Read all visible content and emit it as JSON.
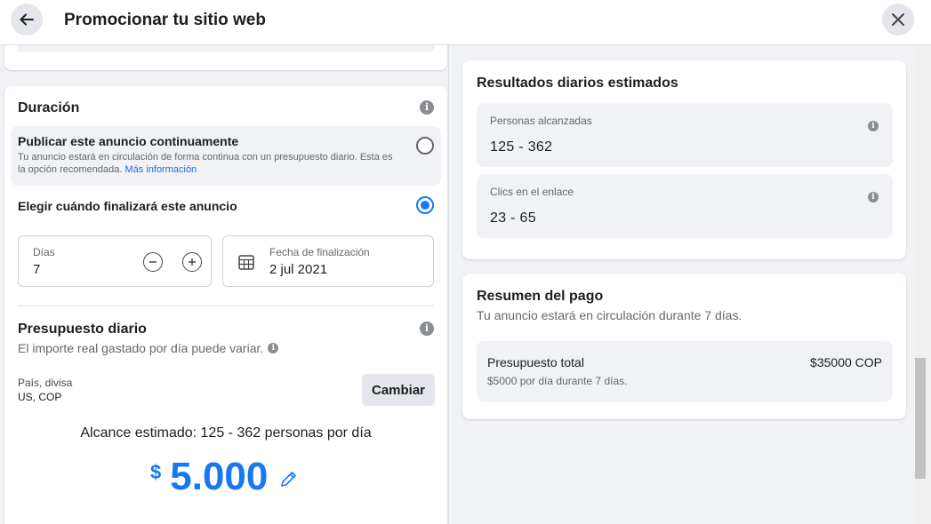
{
  "header": {
    "title": "Promocionar tu sitio web"
  },
  "duration": {
    "title": "Duración",
    "option_continuous": {
      "title": "Publicar este anuncio continuamente",
      "desc": "Tu anuncio estará en circulación de forma continua con un presupuesto diario. Esta es la opción recomendada.",
      "link": "Más información",
      "selected": false
    },
    "option_end": {
      "title": "Elegir cuándo finalizará este anuncio",
      "selected": true
    },
    "days": {
      "label": "Días",
      "value": "7"
    },
    "end_date": {
      "label": "Fecha de finalización",
      "value": "2 jul 2021"
    }
  },
  "budget": {
    "title": "Presupuesto diario",
    "subtitle": "El importe real gastado por día puede variar.",
    "country_label": "País, divisa",
    "country_value": "US, COP",
    "change_button": "Cambiar",
    "reach": "Alcance estimado: 125 - 362 personas por día",
    "currency_symbol": "$",
    "amount": "5.000"
  },
  "results": {
    "title": "Resultados diarios estimados",
    "metrics": [
      {
        "label": "Personas alcanzadas",
        "value": "125 - 362"
      },
      {
        "label": "Clics en el enlace",
        "value": "23 - 65"
      }
    ]
  },
  "summary": {
    "title": "Resumen del pago",
    "subtitle": "Tu anuncio estará en circulación durante 7 días.",
    "total_label": "Presupuesto total",
    "total_value": "$35000 COP",
    "total_detail": "$5000 por día durante 7 días."
  },
  "colors": {
    "accent": "#1877f2",
    "link": "#216fdb",
    "background": "#f0f2f5"
  }
}
